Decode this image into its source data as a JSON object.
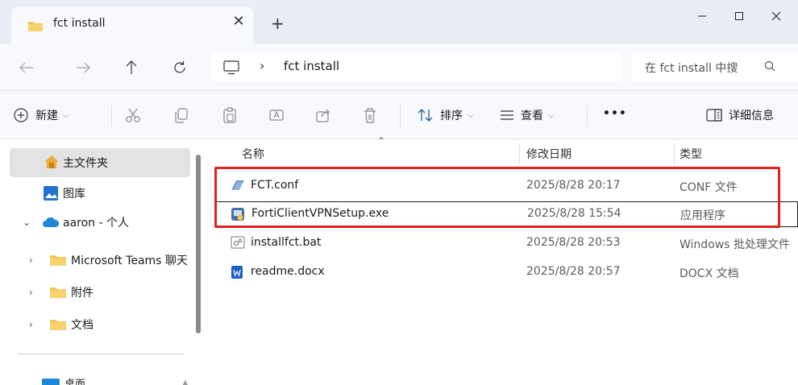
{
  "window": {
    "tab_title": "fct install",
    "tab_close": "✕",
    "new_tab": "+"
  },
  "navigation": {
    "breadcrumb_separator": "›",
    "current_folder": "fct install",
    "search_placeholder": "在 fct install 中搜"
  },
  "commands": {
    "new": "新建",
    "sort": "排序",
    "view": "查看",
    "more": "•••",
    "details": "详细信息"
  },
  "sidebar": {
    "items": [
      {
        "label": "主文件夹",
        "icon": "home-icon"
      },
      {
        "label": "图库",
        "icon": "gallery-icon"
      },
      {
        "label": "aaron - 个人",
        "icon": "onedrive-icon"
      },
      {
        "label": "Microsoft Teams 聊天",
        "icon": "folder-icon"
      },
      {
        "label": "附件",
        "icon": "folder-icon"
      },
      {
        "label": "文档",
        "icon": "folder-icon"
      }
    ],
    "bottom_label": "桌面"
  },
  "columns": {
    "name": "名称",
    "date": "修改日期",
    "type": "类型"
  },
  "files": [
    {
      "name": "FCT.conf",
      "date": "2025/8/28 20:17",
      "type": "CONF 文件",
      "icon": "conf-file-icon"
    },
    {
      "name": "FortiClientVPNSetup.exe",
      "date": "2025/8/28 15:54",
      "type": "应用程序",
      "icon": "installer-icon"
    },
    {
      "name": "installfct.bat",
      "date": "2025/8/28 20:53",
      "type": "Windows 批处理文件",
      "icon": "batch-file-icon"
    },
    {
      "name": "readme.docx",
      "date": "2025/8/28 20:57",
      "type": "DOCX 文档",
      "icon": "word-doc-icon"
    }
  ],
  "colors": {
    "folder": "#f5c451",
    "accent": "#1e88d7",
    "highlight": "#e02121"
  }
}
